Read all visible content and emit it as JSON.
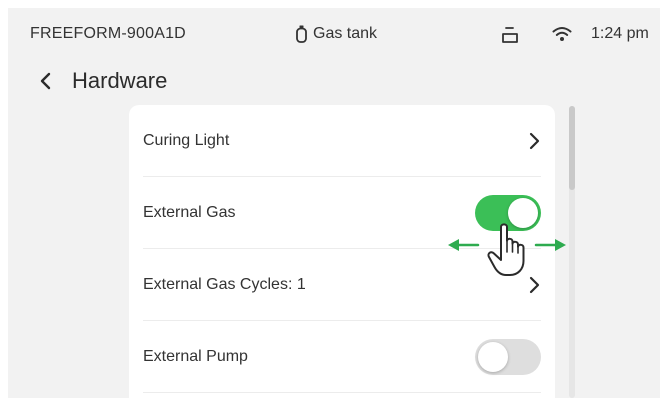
{
  "status_bar": {
    "device_name": "FREEFORM-900A1D",
    "gas_status_label": "Gas tank",
    "gas_icon": "gas-cylinder-icon",
    "tray_icon": "tray-icon",
    "wifi_icon": "wifi-icon",
    "time": "1:24 pm"
  },
  "header": {
    "back_icon": "chevron-left-icon",
    "title": "Hardware"
  },
  "settings": {
    "rows": [
      {
        "label": "Curing Light",
        "control": "chevron"
      },
      {
        "label": "External Gas",
        "control": "toggle",
        "enabled": true
      },
      {
        "label": "External Gas Cycles: 1",
        "control": "chevron"
      },
      {
        "label": "External Pump",
        "control": "toggle",
        "enabled": false
      }
    ]
  },
  "gesture_hint": {
    "icon": "hand-pointer-icon",
    "arrows": "swipe-left-right-arrows"
  },
  "colors": {
    "toggle_on": "#3bbf57",
    "toggle_off": "#dedede",
    "gesture_arrow": "#2eab4f",
    "background": "#f2f2f2",
    "card": "#ffffff"
  }
}
